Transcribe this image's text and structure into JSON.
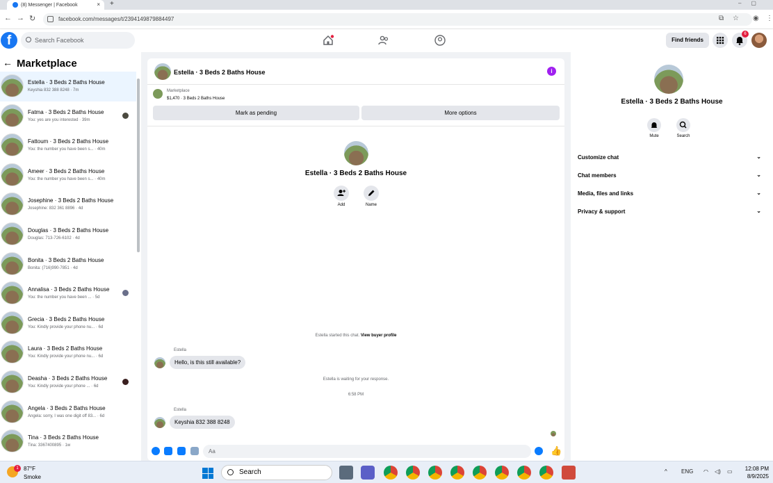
{
  "browser": {
    "tab_title": "(8) Messenger | Facebook",
    "url": "facebook.com/messages/t/2394149879884497"
  },
  "header": {
    "search_placeholder": "Search Facebook",
    "find_friends": "Find friends",
    "notifications_count": "6"
  },
  "sidebar": {
    "title": "Marketplace",
    "conversations": [
      {
        "name": "Estella · 3 Beds 2 Baths House",
        "snippet": "Keyshia 832 388 8248 · 7m",
        "active": true
      },
      {
        "name": "Fatma · 3 Beds 2 Baths House",
        "snippet": "You: yes are you interested · 39m"
      },
      {
        "name": "Fattoum · 3 Beds 2 Baths House",
        "snippet": "You: the number you have been s... · 40m"
      },
      {
        "name": "Ameer · 3 Beds 2 Baths House",
        "snippet": "You: the number you have been s... · 40m"
      },
      {
        "name": "Josephine · 3 Beds 2 Baths House",
        "snippet": "Josephine: 832 361 8896 · 4d"
      },
      {
        "name": "Douglas · 3 Beds 2 Baths House",
        "snippet": "Douglas: 713-726-6102 · 4d"
      },
      {
        "name": "Bonita · 3 Beds 2 Baths House",
        "snippet": "Bonita: (716)990-7851 · 4d"
      },
      {
        "name": "Annalisa · 3 Beds 2 Baths House",
        "snippet": "You: the number you have been ... · 5d"
      },
      {
        "name": "Grecia · 3 Beds 2 Baths House",
        "snippet": "You: Kindly provide your phone nu... · 6d"
      },
      {
        "name": "Laura · 3 Beds 2 Baths House",
        "snippet": "You: Kindly provide your phone nu... · 6d"
      },
      {
        "name": "Deasha · 3 Beds 2 Baths House",
        "snippet": "You: Kindly provide your phone ... · 6d"
      },
      {
        "name": "Angela · 3 Beds 2 Baths House",
        "snippet": "Angela: sorry, I was one digit off 83... · 6d"
      },
      {
        "name": "Tina · 3 Beds 2 Baths House",
        "snippet": "Tina: 3367400895 · 1w"
      }
    ]
  },
  "chat": {
    "title": "Estella · 3 Beds 2 Baths House",
    "marketplace_label": "Marketplace",
    "listing": "$1,470 · 3 Beds 2 Baths House",
    "mark_pending": "Mark as pending",
    "more_options": "More options",
    "contact_name": "Estella · 3 Beds 2 Baths House",
    "add_label": "Add",
    "name_label": "Name",
    "started_text": "Estella started this chat.",
    "view_profile": "View buyer profile",
    "sender": "Estella",
    "msg1": "Hello, is this still available?",
    "waiting": "Estella is waiting for your response.",
    "time": "6:58 PM",
    "msg2": "Keyshia 832 388 8248",
    "composer_placeholder": "Aa"
  },
  "details": {
    "name": "Estella · 3 Beds 2 Baths House",
    "mute": "Mute",
    "search": "Search",
    "sections": [
      "Customize chat",
      "Chat members",
      "Media, files and links",
      "Privacy & support"
    ]
  },
  "taskbar": {
    "temp": "87°F",
    "weather": "Smoke",
    "search": "Search",
    "lang": "ENG",
    "time": "12:08 PM",
    "date": "8/9/2025",
    "weather_badge": "1"
  }
}
